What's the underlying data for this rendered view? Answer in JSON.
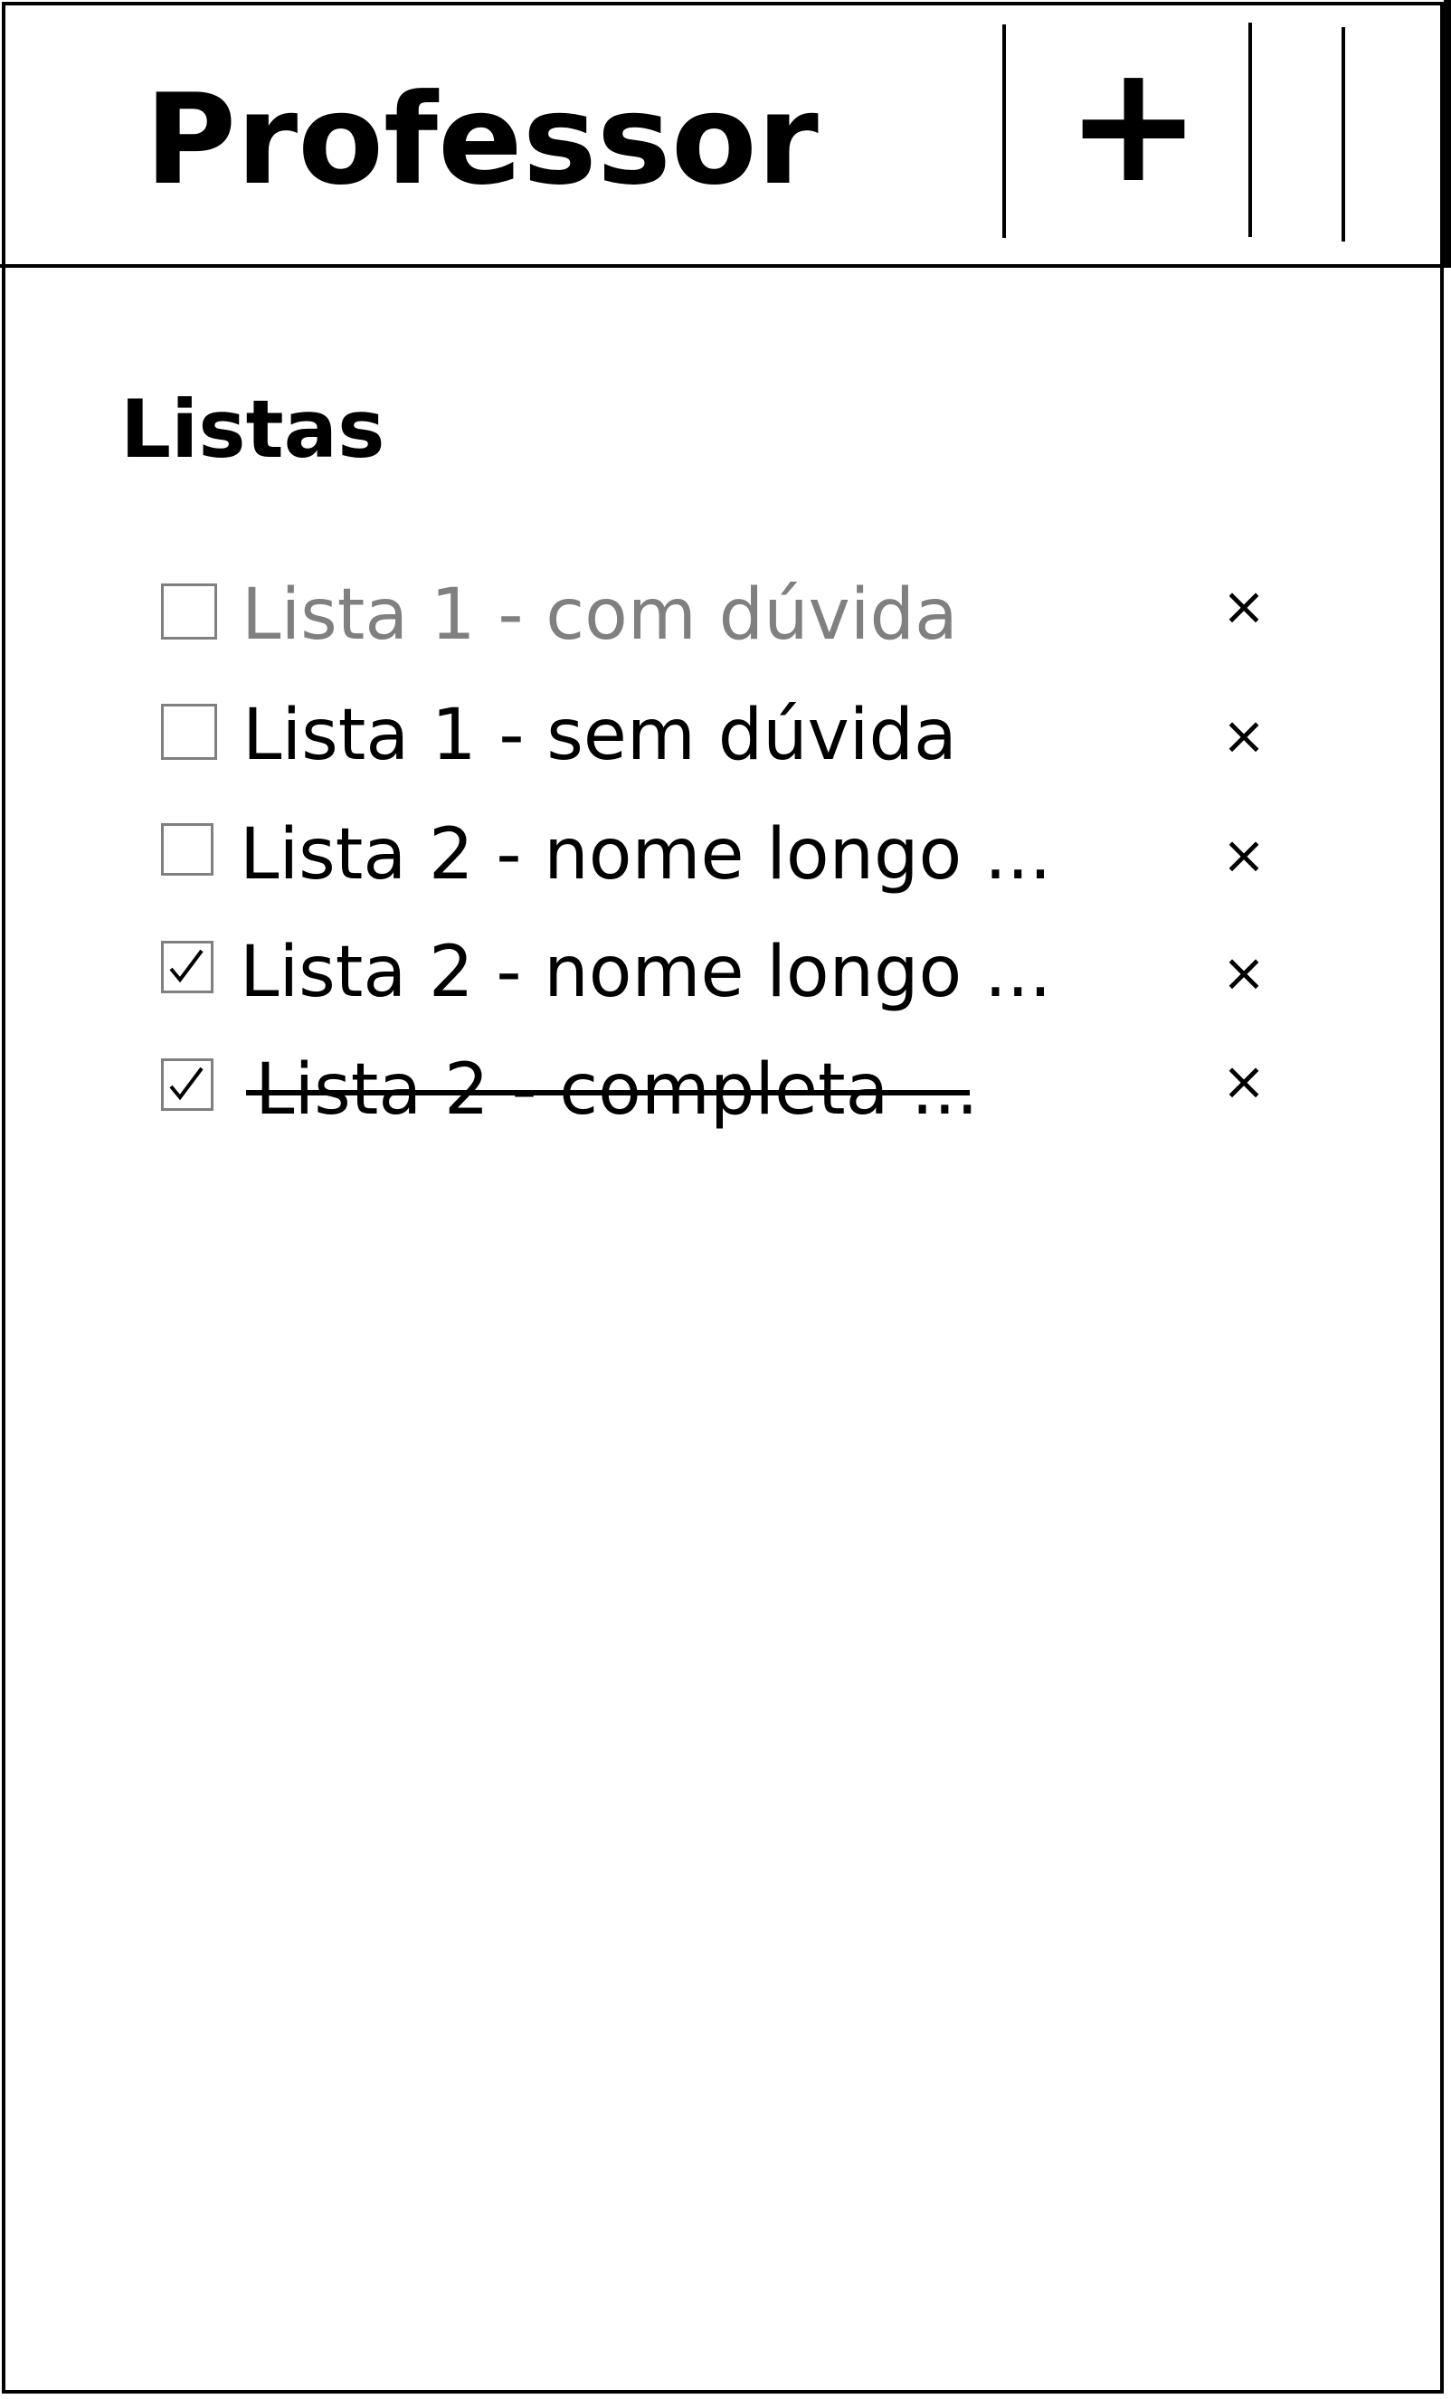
{
  "header": {
    "title": "Professor",
    "add_label": "+"
  },
  "lists_section": {
    "title": "Listas",
    "items": [
      {
        "label": "Lista 1 - com dúvida",
        "checked": false,
        "style": "muted",
        "delete_label": "×"
      },
      {
        "label": "Lista 1 - sem dúvida",
        "checked": false,
        "style": "normal",
        "delete_label": "×"
      },
      {
        "label": "Lista 2 - nome longo ...",
        "checked": false,
        "style": "normal",
        "delete_label": "×"
      },
      {
        "label": "Lista 2 - nome longo ...",
        "checked": true,
        "style": "normal",
        "delete_label": "×"
      },
      {
        "label": "Lista 2 - completa ...",
        "checked": true,
        "style": "strikethrough",
        "delete_label": "×"
      }
    ]
  },
  "colors": {
    "border": "#000000",
    "muted_text": "#808080",
    "checkbox_border": "#808080"
  }
}
